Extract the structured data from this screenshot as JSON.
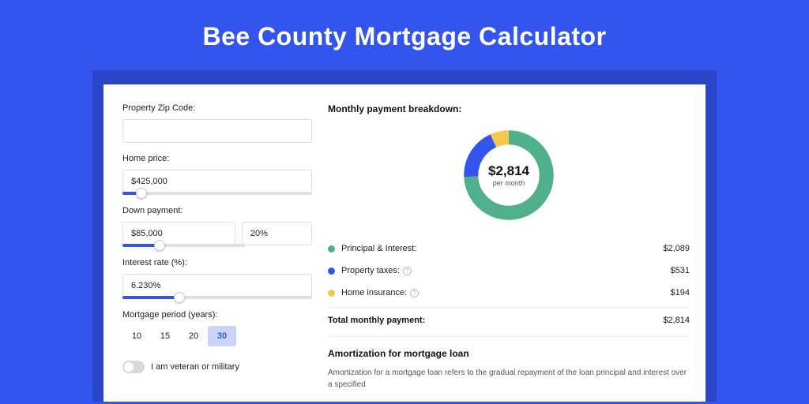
{
  "title": "Bee County Mortgage Calculator",
  "form": {
    "zip_label": "Property Zip Code:",
    "zip_value": "",
    "home_label": "Home price:",
    "home_value": "$425,000",
    "down_label": "Down payment:",
    "down_value": "$85,000",
    "down_pct": "20%",
    "rate_label": "Interest rate (%):",
    "rate_value": "6.230%",
    "period_label": "Mortgage period (years):",
    "periods": {
      "p10": "10",
      "p15": "15",
      "p20": "20",
      "p30": "30"
    },
    "vet_label": "I am veteran or military"
  },
  "breakdown": {
    "title": "Monthly payment breakdown:",
    "center_amount": "$2,814",
    "center_sub": "per month",
    "items": {
      "pi": {
        "label": "Principal & Interest:",
        "value": "$2,089"
      },
      "tax": {
        "label": "Property taxes:",
        "value": "$531"
      },
      "ins": {
        "label": "Home insurance:",
        "value": "$194"
      }
    },
    "total_label": "Total monthly payment:",
    "total_value": "$2,814"
  },
  "amort": {
    "title": "Amortization for mortgage loan",
    "text": "Amortization for a mortgage loan refers to the gradual repayment of the loan principal and interest over a specified"
  },
  "chart_data": {
    "type": "pie",
    "title": "Monthly payment breakdown",
    "series": [
      {
        "name": "Principal & Interest",
        "value": 2089,
        "color": "#4fb08a"
      },
      {
        "name": "Property taxes",
        "value": 531,
        "color": "#3355ee"
      },
      {
        "name": "Home insurance",
        "value": 194,
        "color": "#f2c94c"
      }
    ],
    "total": 2814
  }
}
